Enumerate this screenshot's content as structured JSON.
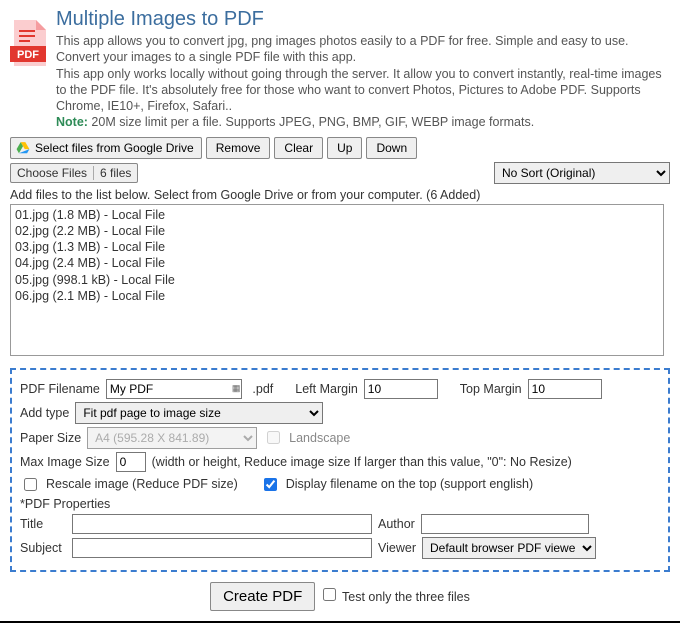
{
  "header": {
    "title": "Multiple Images to PDF",
    "desc1": "This app allows you to convert jpg, png images photos easily to a PDF for free. Simple and easy to use. Convert your images to a single PDF file with this app.",
    "desc2": "This app only works locally without going through the server. It allow you to convert instantly, real-time images to the PDF file. It's absolutely free for those who want to convert Photos, Pictures to Adobe PDF. Supports Chrome, IE10+, Firefox, Safari..",
    "note_label": "Note:",
    "note_text": " 20M size limit per a file. Supports JPEG, PNG, BMP, GIF, WEBP image formats."
  },
  "toolbar": {
    "google_drive": "Select files from Google Drive",
    "remove": "Remove",
    "clear": "Clear",
    "up": "Up",
    "down": "Down",
    "choose_files": "Choose Files",
    "files_count": "6 files",
    "sort_selected": "No Sort (Original)"
  },
  "hint": "Add files to the list below. Select from Google Drive or from your computer. (6 Added)",
  "files": [
    "01.jpg (1.8 MB) - Local File",
    "02.jpg (2.2 MB) - Local File",
    "03.jpg (1.3 MB) - Local File",
    "04.jpg (2.4 MB) - Local File",
    "05.jpg (998.1 kB) - Local File",
    "06.jpg (2.1 MB) - Local File"
  ],
  "options": {
    "filename_label": "PDF Filename",
    "filename_value": "My PDF",
    "pdf_ext": ".pdf",
    "left_margin_label": "Left Margin",
    "left_margin_value": "10",
    "top_margin_label": "Top Margin",
    "top_margin_value": "10",
    "add_type_label": "Add type",
    "add_type_selected": "Fit pdf page to image size",
    "paper_size_label": "Paper Size",
    "paper_size_selected": "A4 (595.28 X 841.89)",
    "landscape_label": "Landscape",
    "max_image_label": "Max Image Size",
    "max_image_value": "0",
    "max_image_hint": "(width or height, Reduce image size If larger than this value, \"0\": No Resize)",
    "rescale_label": "Rescale image (Reduce PDF size)",
    "display_fname_label": "Display filename on the top (support english)",
    "props_header": "*PDF Properties",
    "title_label": "Title",
    "author_label": "Author",
    "subject_label": "Subject",
    "viewer_label": "Viewer",
    "viewer_selected": "Default browser PDF viewer"
  },
  "footer": {
    "create": "Create PDF",
    "test_label": "Test only the three files"
  }
}
